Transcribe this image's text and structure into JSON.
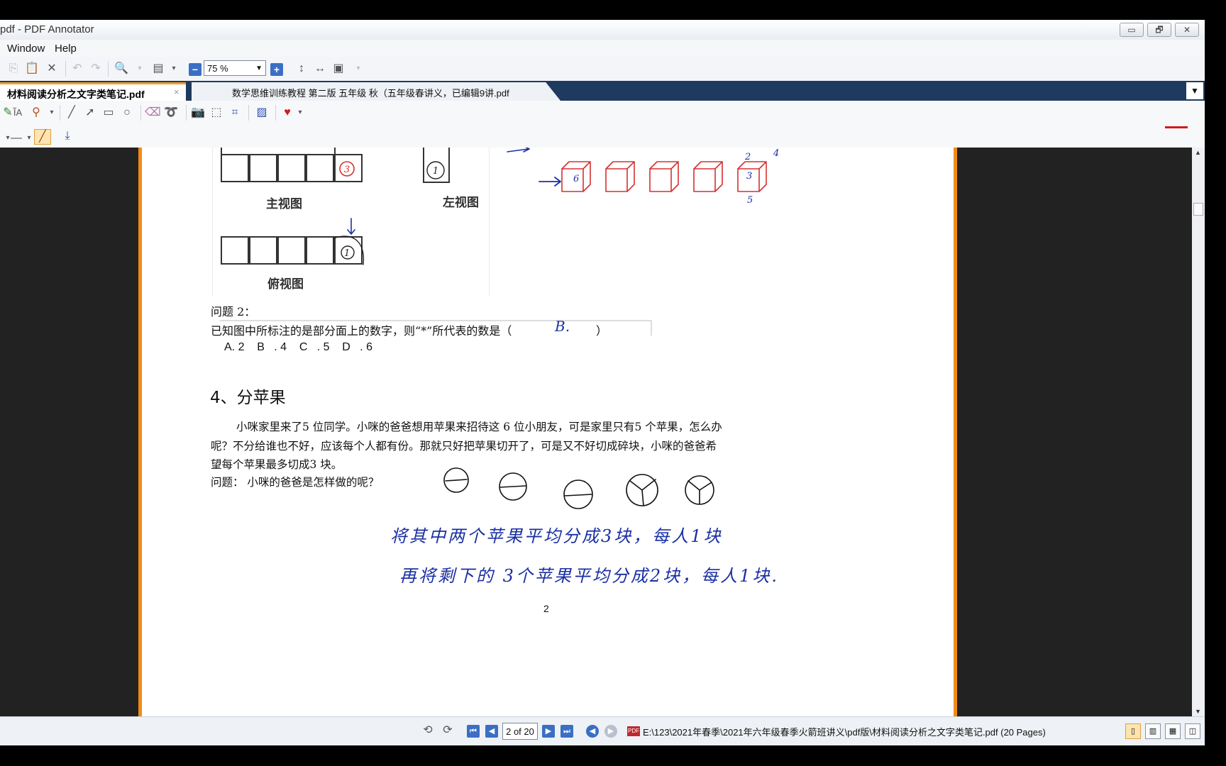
{
  "window": {
    "title": "pdf - PDF Annotator",
    "controls": [
      "▭",
      "🗗",
      "✕"
    ]
  },
  "menu": {
    "items": [
      "Window",
      "Help"
    ]
  },
  "toolbar": {
    "zoom_value": "75 %"
  },
  "tabs": [
    {
      "label": "材料阅读分析之文字类笔记.pdf",
      "close": "×",
      "active": true
    },
    {
      "label": "数学思维训练教程 第二版 五年级 秋（五年级春讲义，已编辑9讲.pdf",
      "active": false
    }
  ],
  "document": {
    "view_labels": {
      "front": "主视图",
      "left": "左视图",
      "top": "俯视图"
    },
    "question2_label": "问题  2：",
    "question2_text": "已知图中所标注的是部分面上的数字，则“*”所代表的数是（",
    "question2_close": "）",
    "question2_options": "A. 2    B   . 4    C   . 5    D   . 6",
    "section_heading": "4、分苹果",
    "para_line1": "小咪家里来了5 位同学。小咪的爸爸想用苹果来招待这 6 位小朋友，可是家里只有5 个苹果，怎么办",
    "para_line2": "呢？不分给谁也不好，应该每个人都有份。那就只好把苹果切开了，可是又不好切成碎块，小咪的爸爸希",
    "para_line3": "望每个苹果最多切成3 块。",
    "question_label": "问题：  小咪的爸爸是怎样做的呢？",
    "page_number": "2",
    "handwriting": {
      "answer": "B.",
      "cube_numbers": [
        "3",
        "1",
        "6",
        "2",
        "3",
        "4",
        "5",
        "1"
      ],
      "solution_line1": "将其中两个苹果平均分成3块，每人1块",
      "solution_line2": "再将剩下的 3个苹果平均分成2块，每人1块."
    }
  },
  "status": {
    "page_field": "2 of 20",
    "path": "E:\\123\\2021年春季\\2021年六年级春季火箭班讲义\\pdf版\\材料阅读分析之文字类笔记.pdf (20 Pages)",
    "pdf_badge": "PDF"
  },
  "colors": {
    "accent_orange": "#ef8b18",
    "tab_bar": "#1f3a5f",
    "handwriting_blue": "#1a2fa3",
    "handwriting_red": "#d63030"
  }
}
